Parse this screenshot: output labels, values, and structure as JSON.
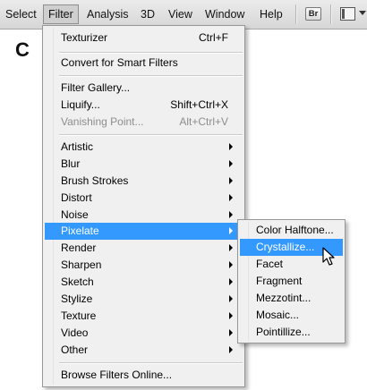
{
  "menubar": {
    "items": [
      {
        "label": "Select"
      },
      {
        "label": "Filter"
      },
      {
        "label": "Analysis"
      },
      {
        "label": "3D"
      },
      {
        "label": "View"
      },
      {
        "label": "Window"
      },
      {
        "label": "Help"
      }
    ],
    "bridge_button": "Br",
    "active": "Filter"
  },
  "canvas": {
    "letter": "C"
  },
  "filter_menu": {
    "items": [
      {
        "label": "Texturizer",
        "shortcut": "Ctrl+F"
      },
      {
        "label": "Convert for Smart Filters"
      },
      {
        "label": "Filter Gallery..."
      },
      {
        "label": "Liquify...",
        "shortcut": "Shift+Ctrl+X"
      },
      {
        "label": "Vanishing Point...",
        "shortcut": "Alt+Ctrl+V",
        "disabled": true
      },
      {
        "label": "Artistic",
        "submenu": true
      },
      {
        "label": "Blur",
        "submenu": true
      },
      {
        "label": "Brush Strokes",
        "submenu": true
      },
      {
        "label": "Distort",
        "submenu": true
      },
      {
        "label": "Noise",
        "submenu": true
      },
      {
        "label": "Pixelate",
        "submenu": true,
        "highlighted": true
      },
      {
        "label": "Render",
        "submenu": true
      },
      {
        "label": "Sharpen",
        "submenu": true
      },
      {
        "label": "Sketch",
        "submenu": true
      },
      {
        "label": "Stylize",
        "submenu": true
      },
      {
        "label": "Texture",
        "submenu": true
      },
      {
        "label": "Video",
        "submenu": true
      },
      {
        "label": "Other",
        "submenu": true
      },
      {
        "label": "Browse Filters Online..."
      }
    ]
  },
  "pixelate_menu": {
    "items": [
      {
        "label": "Color Halftone..."
      },
      {
        "label": "Crystallize...",
        "highlighted": true
      },
      {
        "label": "Facet"
      },
      {
        "label": "Fragment"
      },
      {
        "label": "Mezzotint..."
      },
      {
        "label": "Mosaic..."
      },
      {
        "label": "Pointillize..."
      }
    ]
  },
  "colors": {
    "highlight": "#3399ff",
    "menu_bg": "#f0f0f0",
    "disabled_text": "#8d8d8d"
  },
  "icons": [
    "bridge-icon",
    "workspace-icon",
    "chevron-down-icon",
    "submenu-arrow-icon",
    "cursor-arrow-icon"
  ]
}
